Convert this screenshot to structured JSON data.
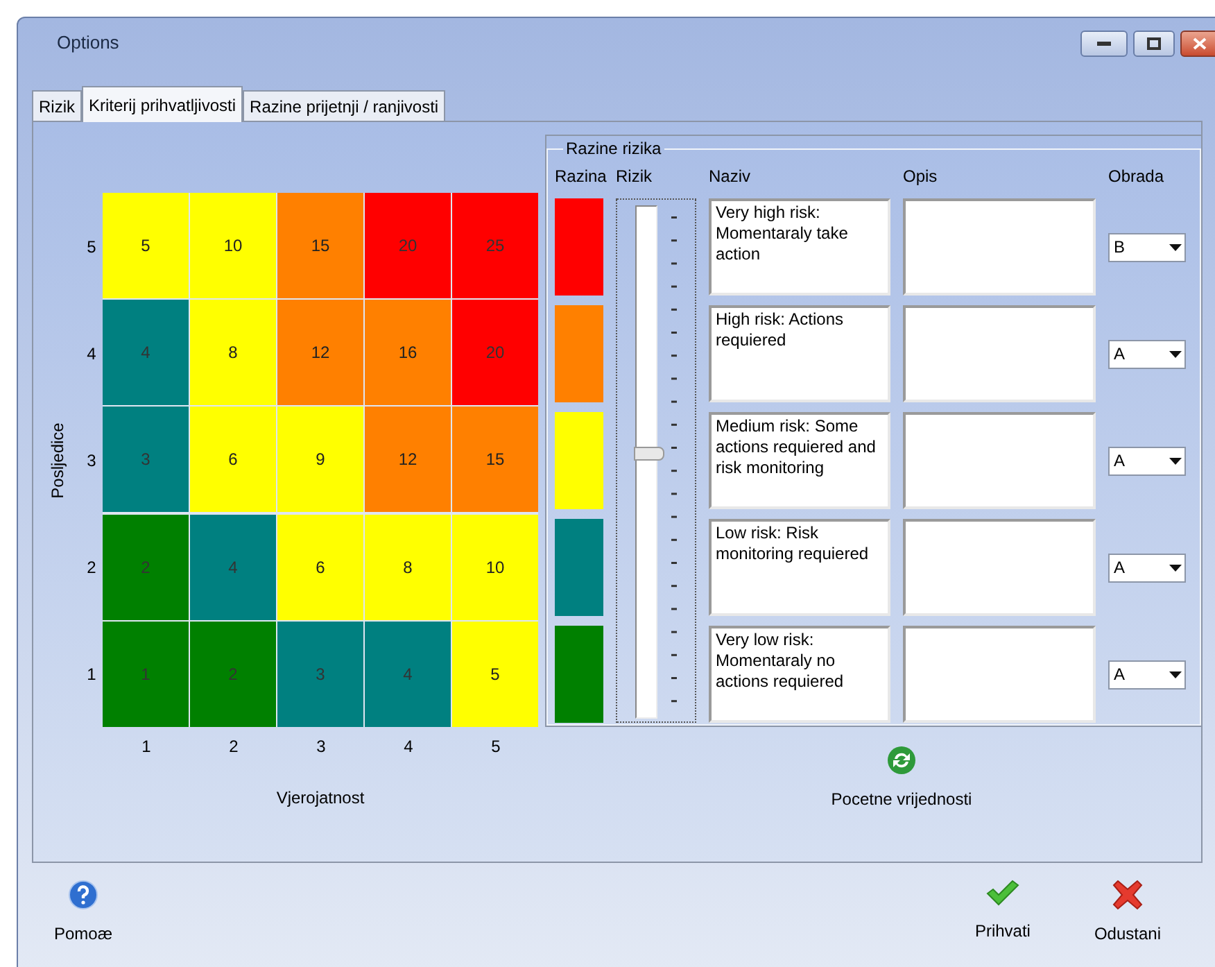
{
  "window": {
    "title": "Options"
  },
  "tabs": [
    {
      "label": "Rizik",
      "selected": false
    },
    {
      "label": "Kriterij prihvatljivosti",
      "selected": true
    },
    {
      "label": "Razine prijetnji / ranjivosti",
      "selected": false
    }
  ],
  "matrix": {
    "y_axis_label": "Posljedice",
    "x_axis_label": "Vjerojatnost",
    "column_labels": [
      "1",
      "2",
      "3",
      "4",
      "5"
    ],
    "rows": [
      {
        "label": "5",
        "cells": [
          {
            "value": "5",
            "color": "#ffff00"
          },
          {
            "value": "10",
            "color": "#ffff00"
          },
          {
            "value": "15",
            "color": "#ff8000"
          },
          {
            "value": "20",
            "color": "#ff0000"
          },
          {
            "value": "25",
            "color": "#ff0000"
          }
        ]
      },
      {
        "label": "4",
        "cells": [
          {
            "value": "4",
            "color": "#008080"
          },
          {
            "value": "8",
            "color": "#ffff00"
          },
          {
            "value": "12",
            "color": "#ff8000"
          },
          {
            "value": "16",
            "color": "#ff8000"
          },
          {
            "value": "20",
            "color": "#ff0000"
          }
        ]
      },
      {
        "label": "3",
        "cells": [
          {
            "value": "3",
            "color": "#008080"
          },
          {
            "value": "6",
            "color": "#ffff00"
          },
          {
            "value": "9",
            "color": "#ffff00"
          },
          {
            "value": "12",
            "color": "#ff8000"
          },
          {
            "value": "15",
            "color": "#ff8000"
          }
        ]
      },
      {
        "label": "2",
        "cells": [
          {
            "value": "2",
            "color": "#008000"
          },
          {
            "value": "4",
            "color": "#008080"
          },
          {
            "value": "6",
            "color": "#ffff00"
          },
          {
            "value": "8",
            "color": "#ffff00"
          },
          {
            "value": "10",
            "color": "#ffff00"
          }
        ]
      },
      {
        "label": "1",
        "cells": [
          {
            "value": "1",
            "color": "#008000"
          },
          {
            "value": "2",
            "color": "#008000"
          },
          {
            "value": "3",
            "color": "#008080"
          },
          {
            "value": "4",
            "color": "#008080"
          },
          {
            "value": "5",
            "color": "#ffff00"
          }
        ]
      }
    ]
  },
  "risk_levels": {
    "title": "Razine rizika",
    "headers": [
      "Razina",
      "Rizik",
      "Naziv",
      "Opis",
      "Obrada"
    ],
    "slider": {
      "level": 0.52
    },
    "rows": [
      {
        "color": "#ff0000",
        "name": "Very high risk: Momentaraly take action",
        "treatment": "B"
      },
      {
        "color": "#ff8000",
        "name": "High risk: Actions requiered",
        "treatment": "A"
      },
      {
        "color": "#ffff00",
        "name": "Medium risk: Some actions requiered and risk monitoring",
        "treatment": "A"
      },
      {
        "color": "#008080",
        "name": "Low risk: Risk monitoring requiered",
        "treatment": "A"
      },
      {
        "color": "#008000",
        "name": "Very low risk: Momentaraly no actions requiered",
        "treatment": "A"
      }
    ]
  },
  "reset_button": {
    "label": "Pocetne vrijednosti"
  },
  "footer_buttons": [
    {
      "kind": "help",
      "label": "Pomoæ"
    },
    {
      "kind": "accept",
      "label": "Prihvati"
    },
    {
      "kind": "cancel",
      "label": "Odustani"
    }
  ]
}
